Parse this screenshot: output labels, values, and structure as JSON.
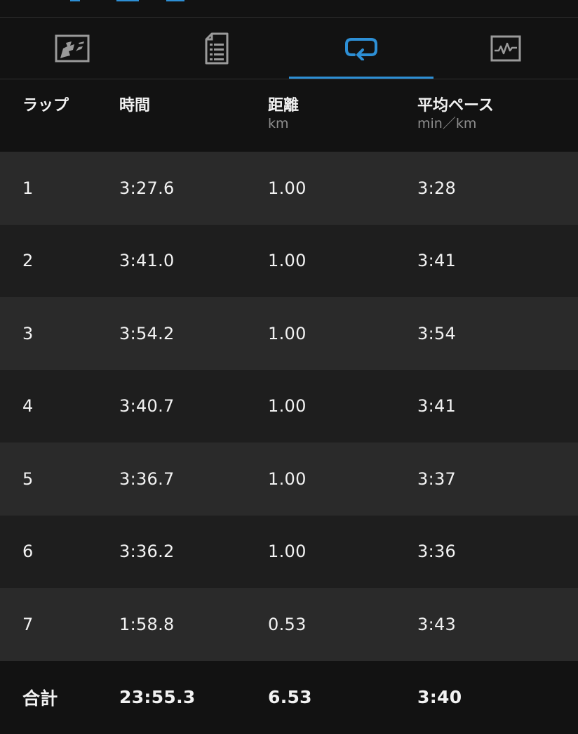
{
  "tabs": [
    {
      "id": "map",
      "icon": "map-icon",
      "active": false
    },
    {
      "id": "details",
      "icon": "document-list-icon",
      "active": false
    },
    {
      "id": "laps",
      "icon": "laps-loop-icon",
      "active": true
    },
    {
      "id": "charts",
      "icon": "chart-icon",
      "active": false
    }
  ],
  "colors": {
    "accent": "#2d8fd5",
    "row_light": "#2a2a2a",
    "row_dark": "#1e1e1e",
    "background": "#121212"
  },
  "table": {
    "headers": {
      "lap": "ラップ",
      "time": "時間",
      "distance": "距離",
      "distance_unit": "km",
      "pace": "平均ペース",
      "pace_unit": "min／km"
    },
    "rows": [
      {
        "lap": "1",
        "time": "3:27.6",
        "distance": "1.00",
        "pace": "3:28"
      },
      {
        "lap": "2",
        "time": "3:41.0",
        "distance": "1.00",
        "pace": "3:41"
      },
      {
        "lap": "3",
        "time": "3:54.2",
        "distance": "1.00",
        "pace": "3:54"
      },
      {
        "lap": "4",
        "time": "3:40.7",
        "distance": "1.00",
        "pace": "3:41"
      },
      {
        "lap": "5",
        "time": "3:36.7",
        "distance": "1.00",
        "pace": "3:37"
      },
      {
        "lap": "6",
        "time": "3:36.2",
        "distance": "1.00",
        "pace": "3:36"
      },
      {
        "lap": "7",
        "time": "1:58.8",
        "distance": "0.53",
        "pace": "3:43"
      }
    ],
    "total": {
      "label": "合計",
      "time": "23:55.3",
      "distance": "6.53",
      "pace": "3:40"
    }
  }
}
